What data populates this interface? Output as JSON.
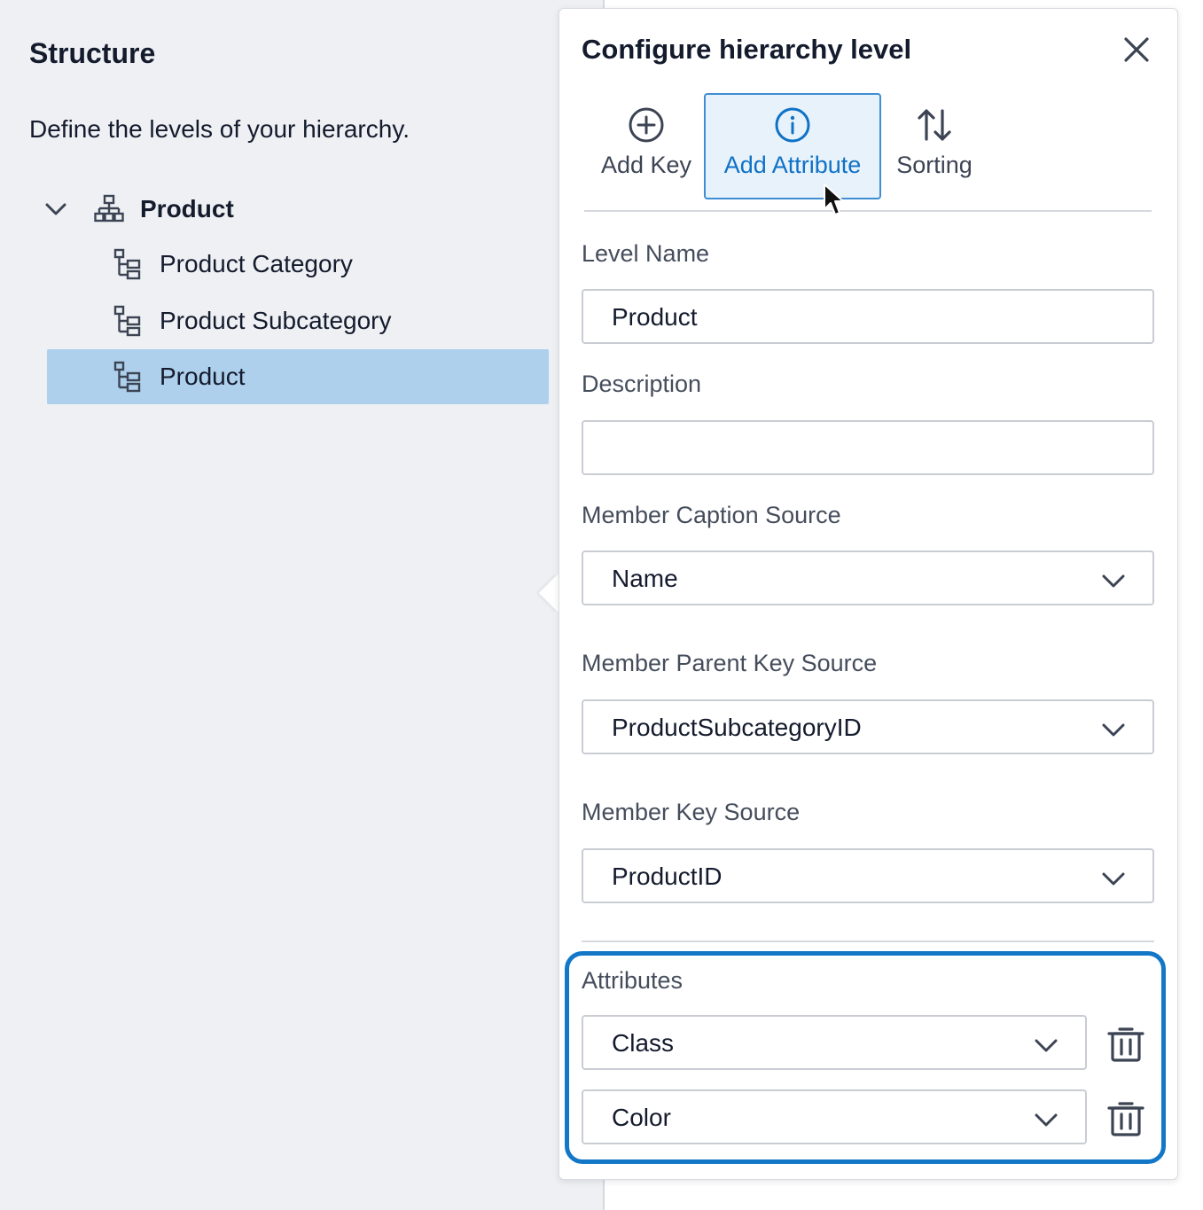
{
  "structure": {
    "title": "Structure",
    "description": "Define the levels of your hierarchy.",
    "root": {
      "label": "Product",
      "expanded": true
    },
    "levels": [
      {
        "label": "Product Category",
        "selected": false
      },
      {
        "label": "Product Subcategory",
        "selected": false
      },
      {
        "label": "Product",
        "selected": true
      }
    ]
  },
  "dialog": {
    "title": "Configure hierarchy level",
    "toolbar": {
      "add_key": "Add Key",
      "add_attribute": "Add Attribute",
      "sorting": "Sorting"
    },
    "level_name_label": "Level Name",
    "level_name_value": "Product",
    "description_label": "Description",
    "description_value": "",
    "caption_source_label": "Member Caption Source",
    "caption_source_value": "Name",
    "parent_key_label": "Member Parent Key Source",
    "parent_key_value": "ProductSubcategoryID",
    "key_source_label": "Member Key Source",
    "key_source_value": "ProductID",
    "attributes_label": "Attributes",
    "attributes": [
      "Class",
      "Color"
    ]
  },
  "colors": {
    "accent": "#0f72c6",
    "selected_row": "#aed0ec",
    "highlight_border": "#1377c7"
  }
}
